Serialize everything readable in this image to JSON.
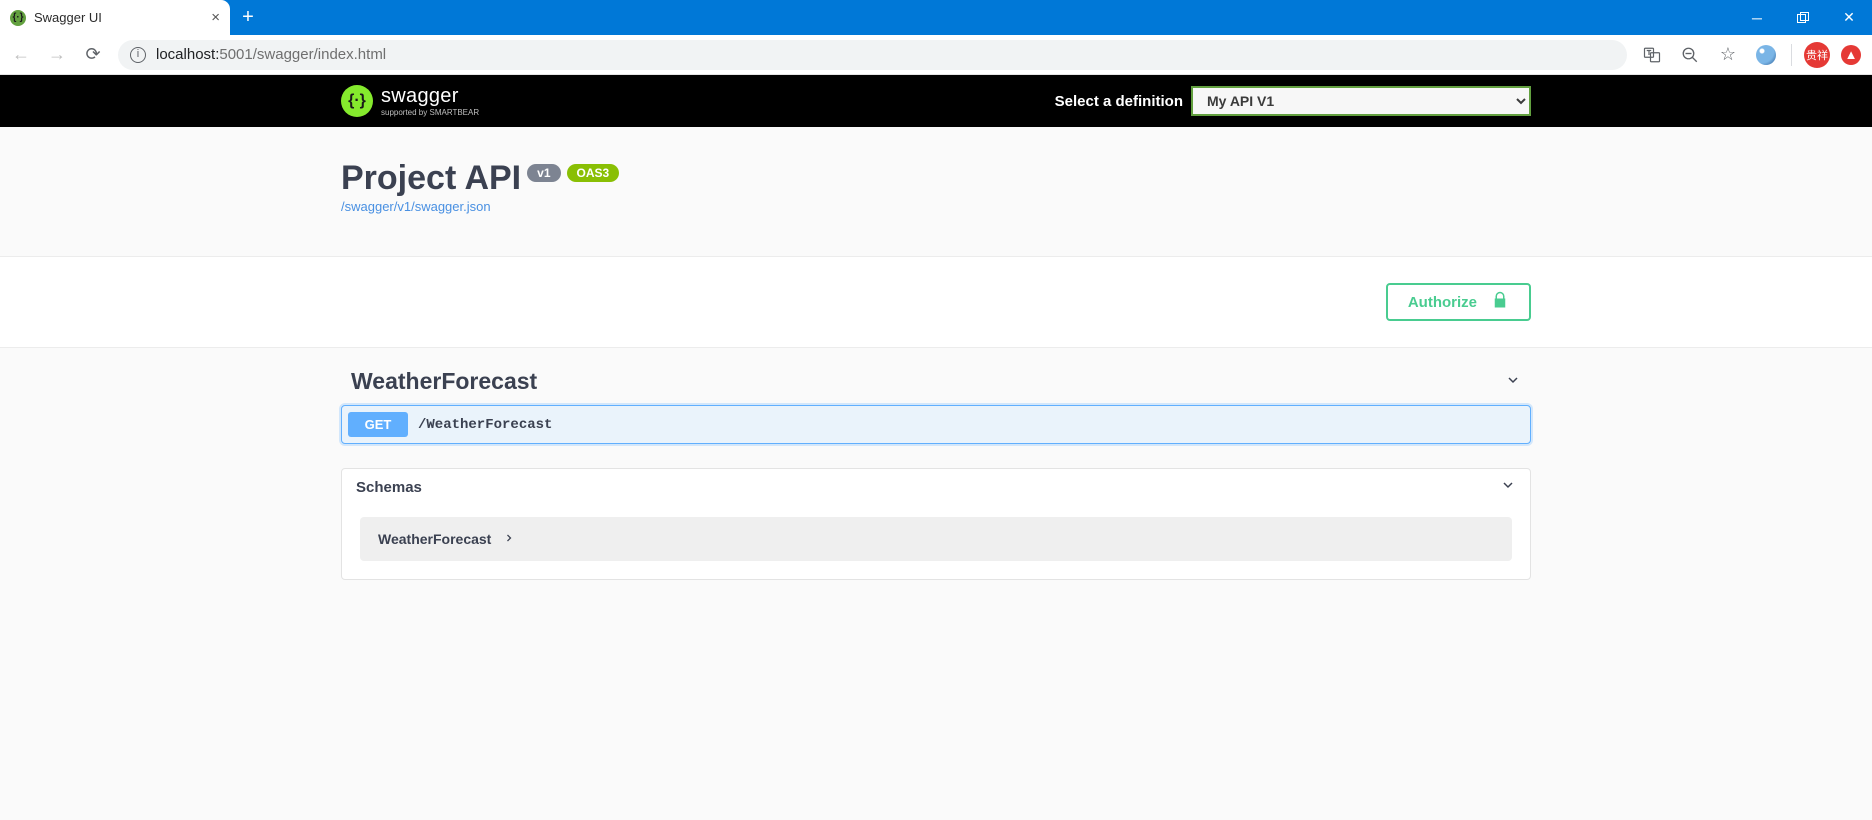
{
  "browser": {
    "tab_title": "Swagger UI",
    "url_host": "localhost:",
    "url_port_path": "5001/swagger/index.html",
    "profile_initials": "贵祥"
  },
  "header": {
    "logo_main": "swagger",
    "logo_sub": "supported by SMARTBEAR",
    "definition_label": "Select a definition",
    "definition_selected": "My API V1"
  },
  "info": {
    "title": "Project API",
    "version_badge": "v1",
    "oas_badge": "OAS3",
    "spec_url": "/swagger/v1/swagger.json"
  },
  "auth": {
    "button_label": "Authorize"
  },
  "tags": [
    {
      "name": "WeatherForecast",
      "operations": [
        {
          "method": "GET",
          "path": "/WeatherForecast"
        }
      ]
    }
  ],
  "schemas": {
    "section_label": "Schemas",
    "items": [
      "WeatherForecast"
    ]
  }
}
